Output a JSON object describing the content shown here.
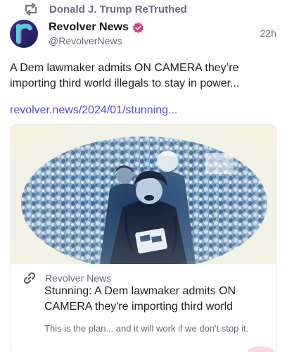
{
  "retruth": {
    "icon": "retruth-icon",
    "label": "Donald J. Trump ReTruthed"
  },
  "author": {
    "display_name": "Revolver News",
    "handle": "@RevolverNews",
    "verified_icon": "verified-badge-icon",
    "avatar_letter": "r",
    "avatar_colors": [
      "#2c2a74",
      "#4ad6d0",
      "#c248b8"
    ],
    "verified_color": "#e6377a"
  },
  "post": {
    "timestamp": "22h",
    "text": "A Dem lawmaker admits ON CAMERA they’re importing third world illegals to stay in power...",
    "link": "revolver.news/2024/01/stunning...",
    "link_color": "#5448ee"
  },
  "card": {
    "source_icon": "link-icon",
    "source": "Revolver News",
    "title": "Stunning: A Dem lawmaker admits ON CAMERA they're importing third world",
    "description": "This is the plan... and it will work if we don't stop it."
  }
}
